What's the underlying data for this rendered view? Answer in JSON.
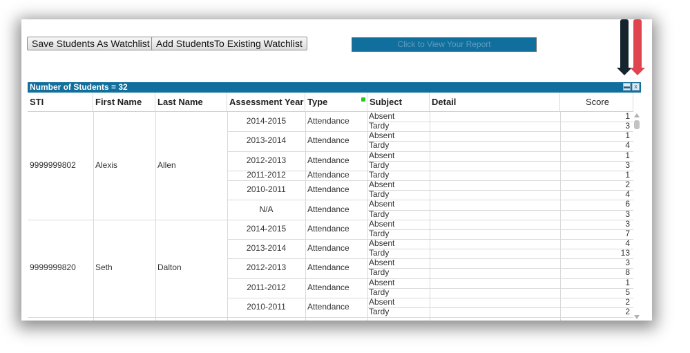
{
  "toolbar": {
    "save_watchlist": "Save Students As Watchlist",
    "add_existing": "Add StudentsTo Existing Watchlist",
    "view_report": "Click to View Your Report"
  },
  "summary": "Number of Students = 32",
  "columns": [
    "STI",
    "First Name",
    "Last Name",
    "Assessment Year",
    "Type",
    "Subject",
    "Detail",
    "Score"
  ],
  "students": [
    {
      "sti": "9999999802",
      "first": "Alexis",
      "last": "Allen",
      "years": [
        {
          "year": "2014-2015",
          "type": "Attendance",
          "rows": [
            [
              "Absent",
              "1"
            ],
            [
              "Tardy",
              "3"
            ]
          ]
        },
        {
          "year": "2013-2014",
          "type": "Attendance",
          "rows": [
            [
              "Absent",
              "1"
            ],
            [
              "Tardy",
              "4"
            ]
          ]
        },
        {
          "year": "2012-2013",
          "type": "Attendance",
          "rows": [
            [
              "Absent",
              "1"
            ],
            [
              "Tardy",
              "3"
            ]
          ]
        },
        {
          "year": "2011-2012",
          "type": "Attendance",
          "rows": [
            [
              "Tardy",
              "1"
            ]
          ]
        },
        {
          "year": "2010-2011",
          "type": "Attendance",
          "rows": [
            [
              "Absent",
              "2"
            ],
            [
              "Tardy",
              "4"
            ]
          ]
        },
        {
          "year": "N/A",
          "type": "Attendance",
          "rows": [
            [
              "Absent",
              "6"
            ],
            [
              "Tardy",
              "3"
            ]
          ]
        }
      ]
    },
    {
      "sti": "9999999820",
      "first": "Seth",
      "last": "Dalton",
      "years": [
        {
          "year": "2014-2015",
          "type": "Attendance",
          "rows": [
            [
              "Absent",
              "3"
            ],
            [
              "Tardy",
              "7"
            ]
          ]
        },
        {
          "year": "2013-2014",
          "type": "Attendance",
          "rows": [
            [
              "Absent",
              "4"
            ],
            [
              "Tardy",
              "13"
            ]
          ]
        },
        {
          "year": "2012-2013",
          "type": "Attendance",
          "rows": [
            [
              "Absent",
              "3"
            ],
            [
              "Tardy",
              "8"
            ]
          ]
        },
        {
          "year": "2011-2012",
          "type": "Attendance",
          "rows": [
            [
              "Absent",
              "1"
            ],
            [
              "Tardy",
              "5"
            ]
          ]
        },
        {
          "year": "2010-2011",
          "type": "Attendance",
          "rows": [
            [
              "Absent",
              "2"
            ],
            [
              "Tardy",
              "2"
            ]
          ]
        }
      ]
    }
  ],
  "colors": {
    "header_bar": "#106f9d",
    "arrow_dark": "#15242d",
    "arrow_red": "#e0454f",
    "filter_dot": "#22cc22"
  },
  "icons": {
    "save": "save-icon",
    "export": "excel-export-icon"
  }
}
